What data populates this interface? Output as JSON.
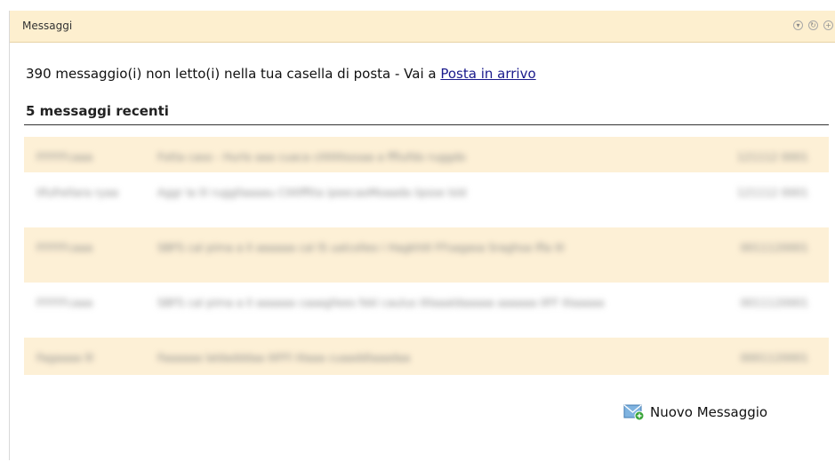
{
  "widget": {
    "title": "Messaggi"
  },
  "header_icons": [
    "collapse-icon",
    "refresh-icon",
    "add-icon"
  ],
  "unread": {
    "text": "390 messaggio(i) non letto(i) nella tua casella di posta - Vai a ",
    "link_label": "Posta in arrivo"
  },
  "recent": {
    "heading": "5 messaggi recenti",
    "rows": [
      {
        "from": "FFFFFcaaa",
        "subject": "Fotta caso - Hurlo aaa cuaca cIIIIIIIIsssaa a ffllufdo ruggdo",
        "date": "121112 0001",
        "shaded": true
      },
      {
        "from": "IIfufrellara ryaa",
        "subject": "Aggr la lil ruggllaaaau CIIIIlfftta ipeecaoMoaada iipsse lsld",
        "date": "121112 0001",
        "shaded": false
      },
      {
        "from": "FFFFFcaaa",
        "subject": "SBFS cal pima a II aaaaaa cal lS ualcolleo i HagkhIII FFsagasa Sraghsa lfla III",
        "date": "0011120001",
        "shaded": true
      },
      {
        "from": "FFFFFcaaa",
        "subject": "SBFS cal pima a II aaaaaa caaagllees fekl caulus IIIlaaaldaaaaa aaaaaa IIFF IIIaaaaa",
        "date": "0011120001",
        "shaded": false
      },
      {
        "from": "Fagaaaa lll",
        "subject": "Faaaaaa laldadddaa IIIFFI IIIaaa cuaaddlaaadaa",
        "date": "0001120001",
        "shaded": true
      }
    ]
  },
  "new_message": {
    "label": "Nuovo Messaggio",
    "icon": "envelope-new-icon"
  },
  "colors": {
    "header_bg": "#fdefcf",
    "row_shade": "#fdf0d6",
    "link": "#1a1a8c"
  }
}
